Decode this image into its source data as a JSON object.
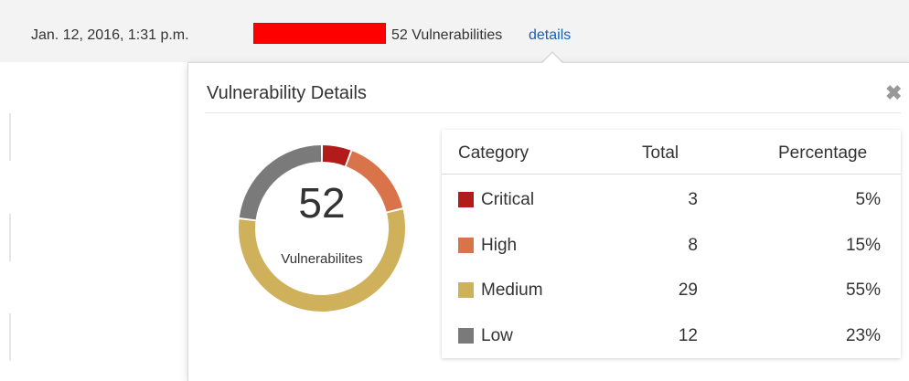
{
  "header": {
    "date": "Jan. 12, 2016, 1:31 p.m.",
    "count_text": "52 Vulnerabilities",
    "details_link": "details"
  },
  "popover": {
    "title": "Vulnerability Details",
    "close_icon": "close-icon",
    "donut": {
      "total": "52",
      "label": "Vulnerabilites"
    },
    "table": {
      "headers": [
        "Category",
        "Total",
        "Percentage"
      ],
      "rows": [
        {
          "category": "Critical",
          "total": "3",
          "percentage": "5%",
          "color": "#b31b1b",
          "value": 3
        },
        {
          "category": "High",
          "total": "8",
          "percentage": "15%",
          "color": "#d9734a",
          "value": 8
        },
        {
          "category": "Medium",
          "total": "29",
          "percentage": "55%",
          "color": "#cfb15c",
          "value": 29
        },
        {
          "category": "Low",
          "total": "12",
          "percentage": "23%",
          "color": "#7a7a7a",
          "value": 12
        }
      ]
    }
  },
  "colors": {
    "severity_bar": "#ff0000",
    "link": "#1a5fb4"
  }
}
